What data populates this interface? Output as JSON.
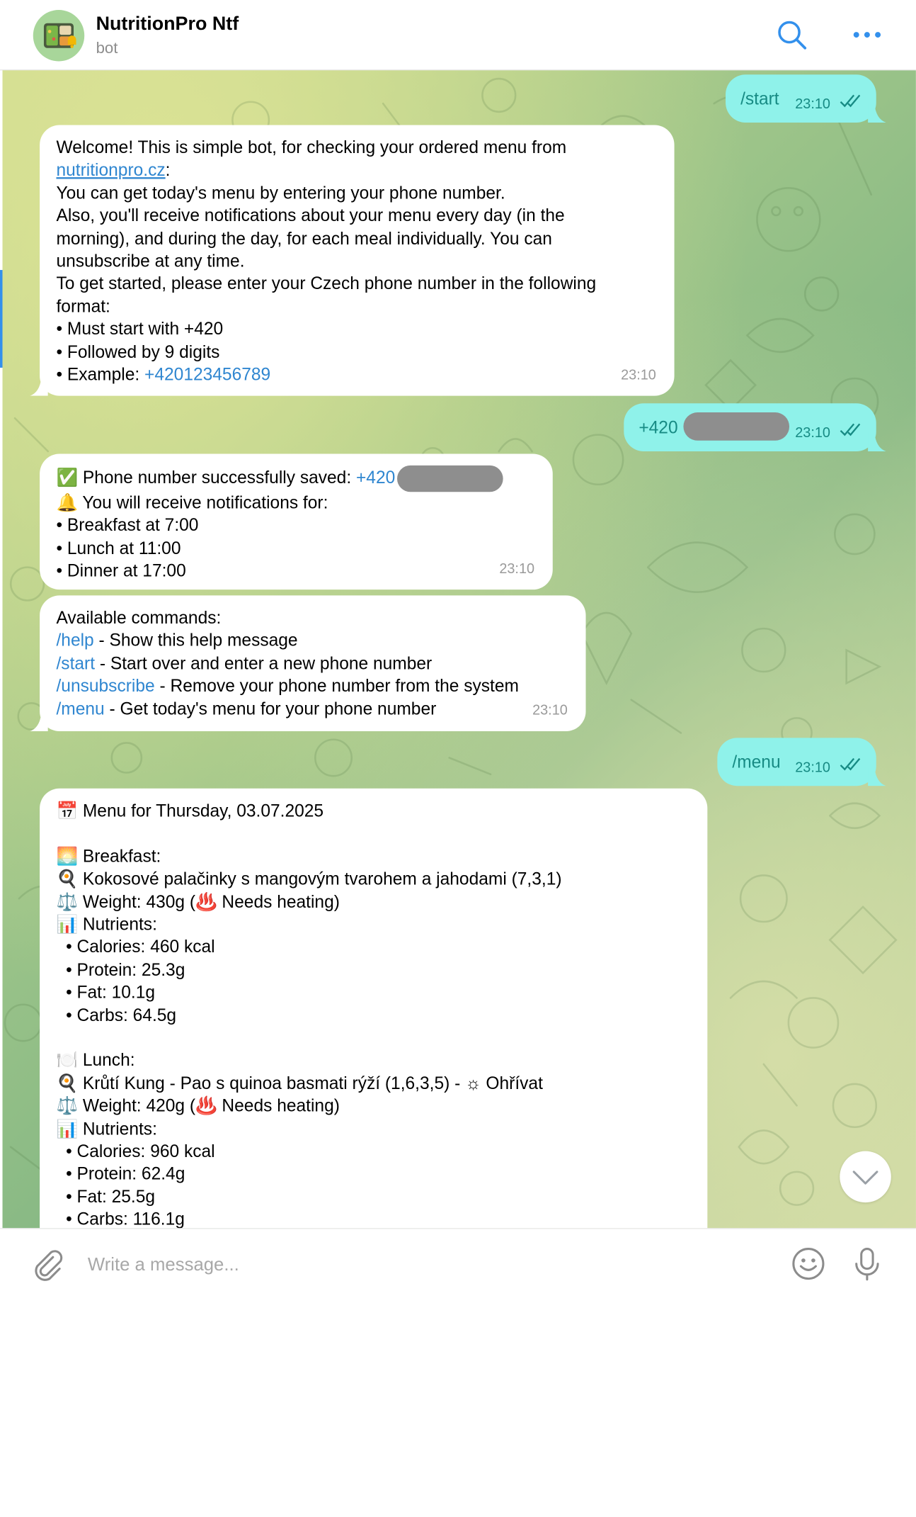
{
  "header": {
    "title": "NutritionPro Ntf",
    "subtitle": "bot"
  },
  "messages": {
    "m1": {
      "text": "/start",
      "time": "23:10"
    },
    "m2": {
      "line1": "Welcome! This is simple bot, for checking your ordered menu from",
      "link": "nutritionpro.cz",
      "link_suffix": ":",
      "line3": "You can get today's menu by entering your phone number.",
      "line4": "Also, you'll receive notifications about your menu every day (in the",
      "line5": "morning), and during the day, for each meal individually. You can",
      "line6": "unsubscribe at any time.",
      "line7": "To get started, please enter your Czech phone number in the following",
      "line8": "format:",
      "line9": "• Must start with +420",
      "line10": "• Followed by 9 digits",
      "line11_prefix": "• Example: ",
      "example_phone": "+420123456789",
      "time": "23:10"
    },
    "m3": {
      "text": "+420",
      "time": "23:10"
    },
    "m4": {
      "line1_prefix": "✅ Phone number successfully saved: ",
      "phone_prefix": "+420",
      "line2": "🔔 You will receive notifications for:",
      "line3": "• Breakfast at 7:00",
      "line4": "• Lunch at 11:00",
      "line5": "• Dinner at 17:00",
      "time": "23:10"
    },
    "m5": {
      "title": "Available commands:",
      "commands": [
        {
          "cmd": "/help",
          "desc": " - Show this help message"
        },
        {
          "cmd": "/start",
          "desc": " - Start over and enter a new phone number"
        },
        {
          "cmd": "/unsubscribe",
          "desc": " - Remove your phone number from the system"
        },
        {
          "cmd": "/menu",
          "desc": " - Get today's menu for your phone number"
        }
      ],
      "time": "23:10"
    },
    "m6": {
      "text": "/menu",
      "time": "23:10"
    },
    "m7": {
      "lines": [
        "📅 Menu for Thursday, 03.07.2025",
        "",
        "🌅 Breakfast:",
        "🍳 Kokosové palačinky s mangovým tvarohem a jahodami (7,3,1)",
        "⚖️ Weight: 430g (♨️ Needs heating)",
        "📊 Nutrients:",
        "  • Calories: 460 kcal",
        "  • Protein: 25.3g",
        "  • Fat: 10.1g",
        "  • Carbs: 64.5g",
        "",
        "🍽️ Lunch:",
        "🍳 Krůtí Kung - Pao s quinoa basmati rýží (1,6,3,5) - ☼ Ohřívat",
        "⚖️ Weight: 420g (♨️ Needs heating)",
        "📊 Nutrients:",
        "  • Calories: 960 kcal",
        "  • Protein: 62.4g",
        "  • Fat: 25.5g",
        "  • Carbs: 116.1g"
      ]
    }
  },
  "composer": {
    "placeholder": "Write a message..."
  },
  "icons": {
    "header": [
      "search-icon",
      "more-icon"
    ],
    "composer": [
      "attach-icon",
      "emoji-icon",
      "microphone-icon"
    ],
    "scroll": "chevron-down-icon"
  },
  "colors": {
    "outgoing_bubble": "#8ff2ea",
    "outgoing_text": "#178b84",
    "link": "#2f86d0",
    "accent": "#3390ec"
  }
}
